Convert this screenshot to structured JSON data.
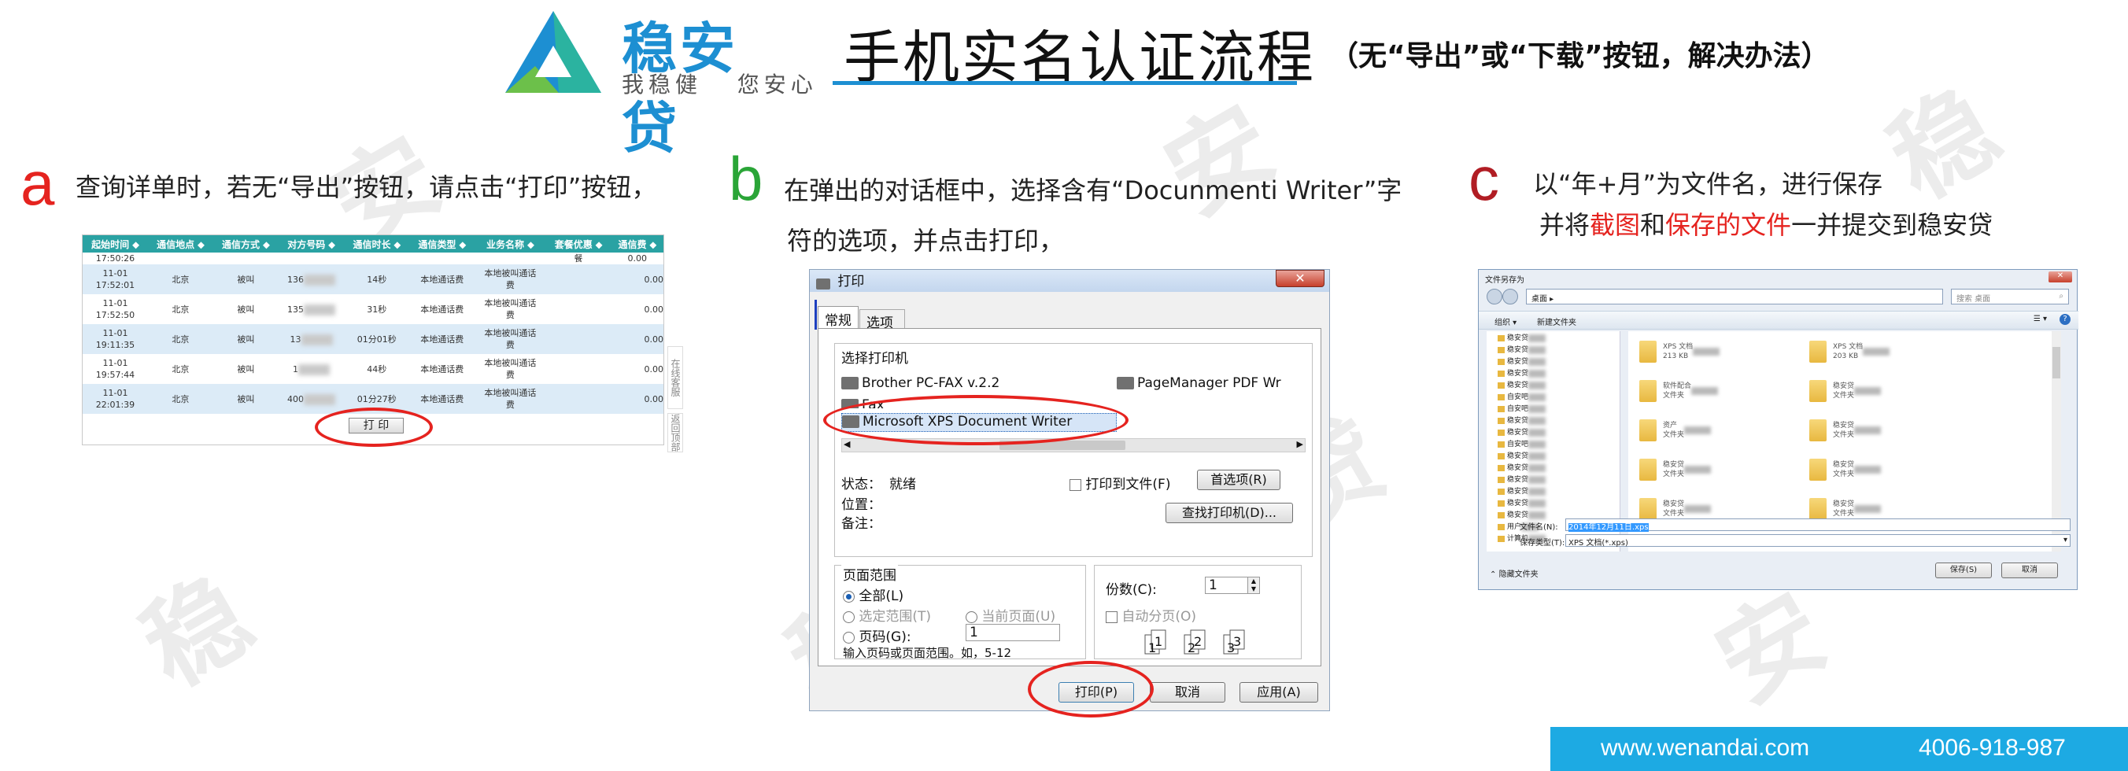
{
  "header": {
    "logo_text": "稳安贷",
    "logo_sub": "我稳健   您安心",
    "title": "手机实名认证流程",
    "note": "（无“导出”或“下载”按钮，解决办法）"
  },
  "watermark": "安贷稳",
  "steps": {
    "a": {
      "letter": "a",
      "text": "查询详单时，若无“导出”按钮，请点击“打印”按钮，",
      "color": "#e5231f"
    },
    "b": {
      "letter": "b",
      "line1": "在弹出的对话框中，选择含有“Docunmenti Writer”字",
      "line2": "符的选项，并点击打印，",
      "color": "#2aa537"
    },
    "c": {
      "letter": "c",
      "line1": "以“年+月”为文件名，进行保存",
      "line2_pre": "并将",
      "line2_red1": "截图",
      "line2_mid": "和",
      "line2_red2": "保存的文件",
      "line2_post": "一并提交到稳安贷",
      "color": "#b11d24"
    }
  },
  "call_table": {
    "headers": [
      "起始时间 ⬥",
      "通信地点 ⬥",
      "通信方式 ⬥",
      "对方号码 ⬥",
      "通信时长 ⬥",
      "通信类型 ⬥",
      "业务名称 ⬥",
      "套餐优惠 ⬥",
      "通信费 ⬥"
    ],
    "top_partial": {
      "time": "17:50:26",
      "fee": "0.00",
      "pkg": "餐"
    },
    "rows": [
      {
        "date": "11-01",
        "time": "17:52:01",
        "place": "北京",
        "mode": "被叫",
        "num": "136",
        "dur": "14秒",
        "type": "本地通话费",
        "biz1": "本地被叫通话",
        "biz2": "费",
        "fee": "0.00"
      },
      {
        "date": "11-01",
        "time": "17:52:50",
        "place": "北京",
        "mode": "被叫",
        "num": "135",
        "dur": "31秒",
        "type": "本地通话费",
        "biz1": "本地被叫通话",
        "biz2": "费",
        "fee": "0.00"
      },
      {
        "date": "11-01",
        "time": "19:11:35",
        "place": "北京",
        "mode": "被叫",
        "num": "13",
        "dur": "01分01秒",
        "type": "本地通话费",
        "biz1": "本地被叫通话",
        "biz2": "费",
        "fee": "0.00"
      },
      {
        "date": "11-01",
        "time": "19:57:44",
        "place": "北京",
        "mode": "被叫",
        "num": "1",
        "dur": "44秒",
        "type": "本地通话费",
        "biz1": "本地被叫通话",
        "biz2": "费",
        "fee": "0.00"
      },
      {
        "date": "11-01",
        "time": "22:01:39",
        "place": "北京",
        "mode": "被叫",
        "num": "400",
        "dur": "01分27秒",
        "type": "本地通话费",
        "biz1": "本地被叫通话",
        "biz2": "费",
        "fee": "0.00"
      }
    ],
    "print_button": "打 印",
    "side_tab1": "在线客服",
    "side_tab2": "返回顶部"
  },
  "print_dialog": {
    "title": "打印",
    "tab_general": "常规",
    "tab_options": "选项",
    "select_printer_label": "选择打印机",
    "printers": [
      "Brother PC-FAX v.2.2",
      "PageManager PDF Wr",
      "Fax",
      "Microsoft XPS Document Writer"
    ],
    "status_label": "状态：",
    "status_value": "就绪",
    "location_label": "位置：",
    "comment_label": "备注：",
    "print_to_file": "打印到文件(F)",
    "preferences_button": "首选项(R)",
    "find_printer_button": "查找打印机(D)...",
    "page_range_label": "页面范围",
    "range_all": "全部(L)",
    "range_selection": "选定范围(T)",
    "range_current": "当前页面(U)",
    "range_pages": "页码(G):",
    "pages_value": "1",
    "pages_hint": "输入页码或页面范围。如，5-12",
    "copies_label": "份数(C):",
    "copies_value": "1",
    "collate_label": "自动分页(O)",
    "print_button": "打印(P)",
    "cancel_button": "取消",
    "apply_button": "应用(A)"
  },
  "save_dialog": {
    "title": "文件另存为",
    "breadcrumb": "桌面 ▸",
    "search_placeholder": "搜索 桌面",
    "organize": "组织 ▾",
    "new_folder": "新建文件夹",
    "sidebar": [
      "稳安贷",
      "稳安贷",
      "稳安贷",
      "稳安贷",
      "稳安贷",
      "自安吧",
      "自安吧",
      "稳安贷",
      "稳安贷",
      "自安吧",
      "稳安贷",
      "稳安贷",
      "稳安贷",
      "稳安贷",
      "稳安贷",
      "稳安贷",
      "用户",
      "计算机"
    ],
    "files_left": [
      {
        "name": "XPS 文档",
        "sub": "213 KB"
      },
      {
        "name": "软件配合",
        "sub": "文件夹"
      },
      {
        "name": "资产",
        "sub": "文件夹"
      },
      {
        "name": "稳安贷",
        "sub": "文件夹"
      },
      {
        "name": "稳安贷",
        "sub": "文件夹"
      }
    ],
    "files_right": [
      {
        "name": "XPS 文档",
        "sub": "203 KB"
      },
      {
        "name": "稳安贷",
        "sub": "文件夹"
      },
      {
        "name": "稳安贷",
        "sub": "文件夹"
      },
      {
        "name": "稳安贷",
        "sub": "文件夹"
      },
      {
        "name": "稳安贷",
        "sub": "文件夹"
      }
    ],
    "filename_label": "文件名(N):",
    "filename_value": "2014年12月11日.xps",
    "filetype_label": "保存类型(T):",
    "filetype_value": "XPS 文档(*.xps)",
    "hide_folders": "隐藏文件夹",
    "save_button": "保存(S)",
    "cancel_button": "取消"
  },
  "footer": {
    "url": "www.wenandai.com",
    "phone": "4006-918-987"
  },
  "colors": {
    "brand_blue": "#1d8fd2",
    "footer_blue": "#1daae3",
    "highlight_red": "#e5231f",
    "table_header": "#2aa2a3"
  }
}
